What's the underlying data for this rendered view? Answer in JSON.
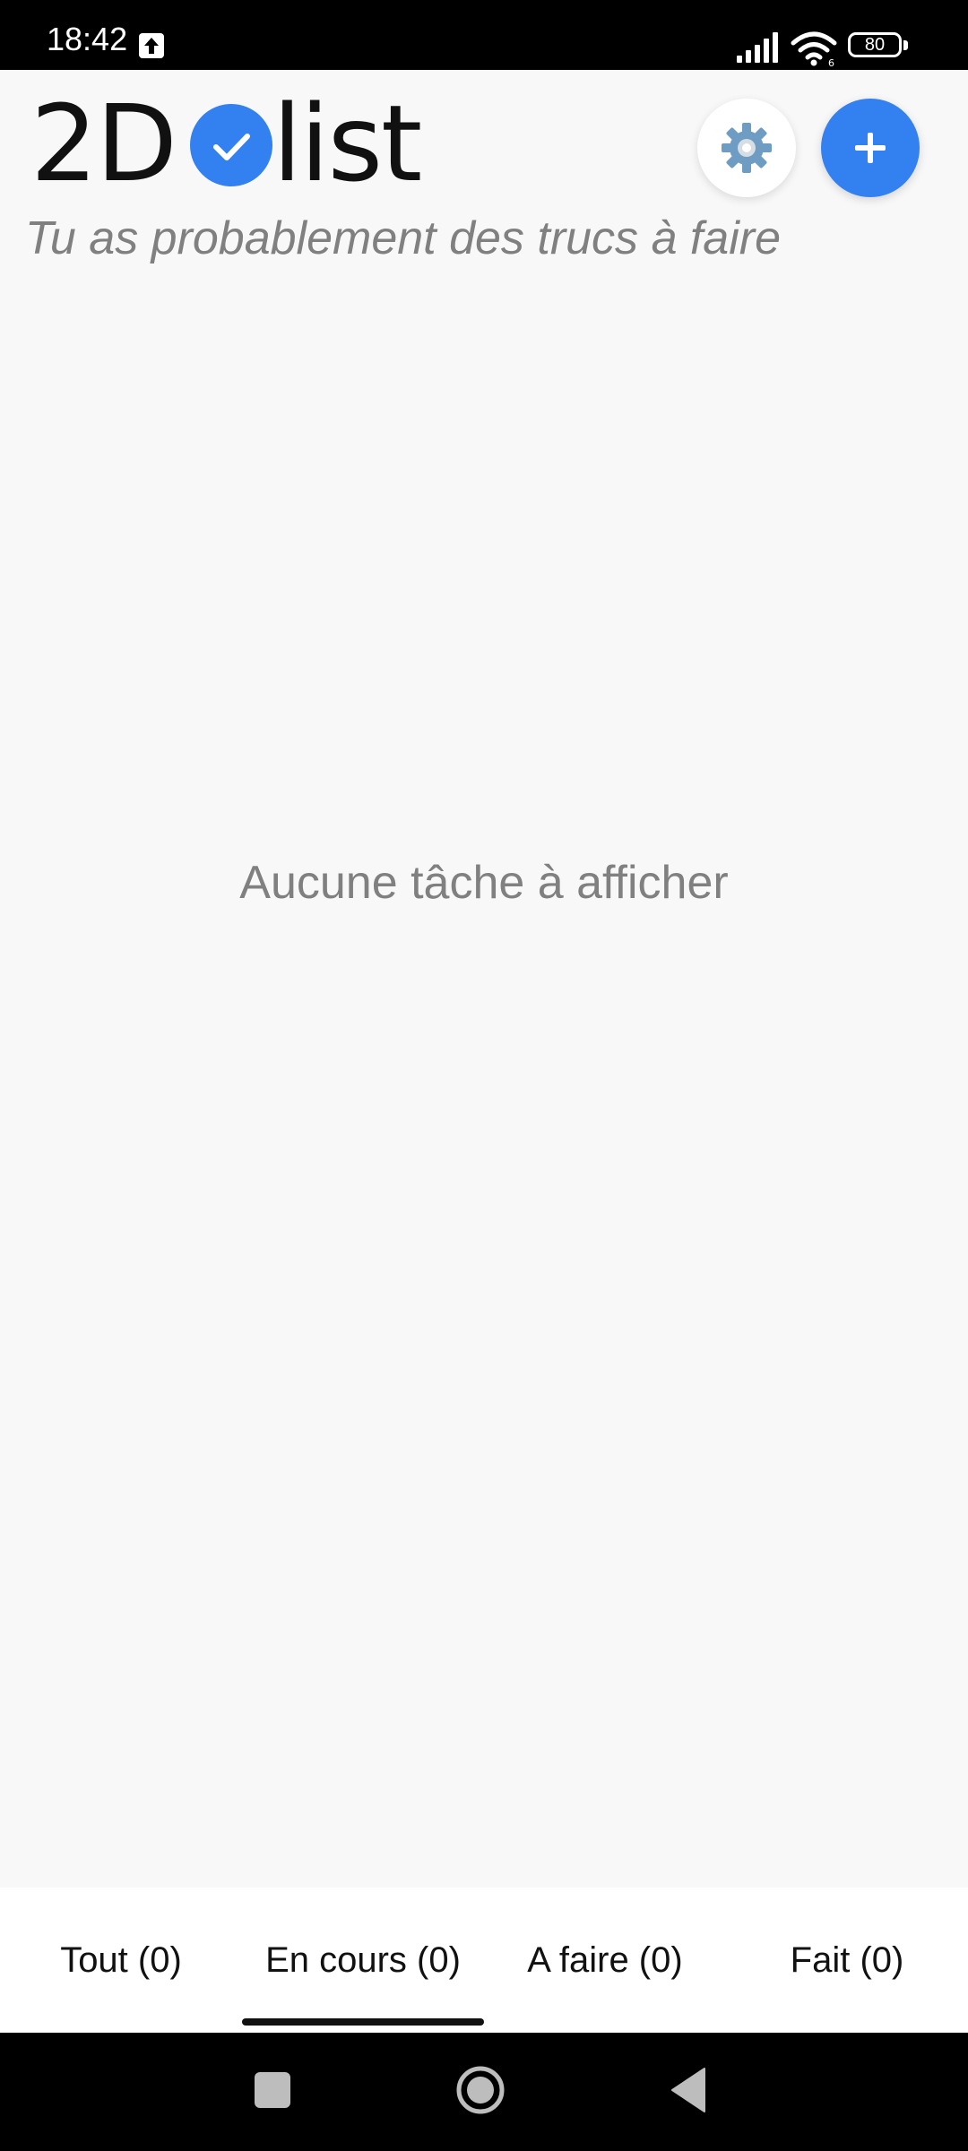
{
  "status_bar": {
    "time": "18:42",
    "battery_level": "80",
    "icons": [
      "upload-icon",
      "signal-icon",
      "wifi-icon",
      "battery-icon"
    ]
  },
  "header": {
    "logo_left": "2D",
    "logo_right": "list",
    "logo_icon": "check-circle-icon",
    "subtitle": "Tu as probablement des trucs à faire",
    "settings_icon": "gear-icon",
    "add_icon": "plus-icon"
  },
  "main": {
    "empty_message": "Aucune tâche à afficher"
  },
  "tabs": [
    {
      "label": "Tout (0)",
      "selected": false
    },
    {
      "label": "En cours (0)",
      "selected": true
    },
    {
      "label": "A faire (0)",
      "selected": false
    },
    {
      "label": "Fait (0)",
      "selected": false
    }
  ],
  "nav_bar": {
    "icons": [
      "recents-icon",
      "home-icon",
      "back-icon"
    ]
  },
  "colors": {
    "accent": "#3381f0",
    "background": "#f8f8f8",
    "muted_text": "#808080"
  }
}
